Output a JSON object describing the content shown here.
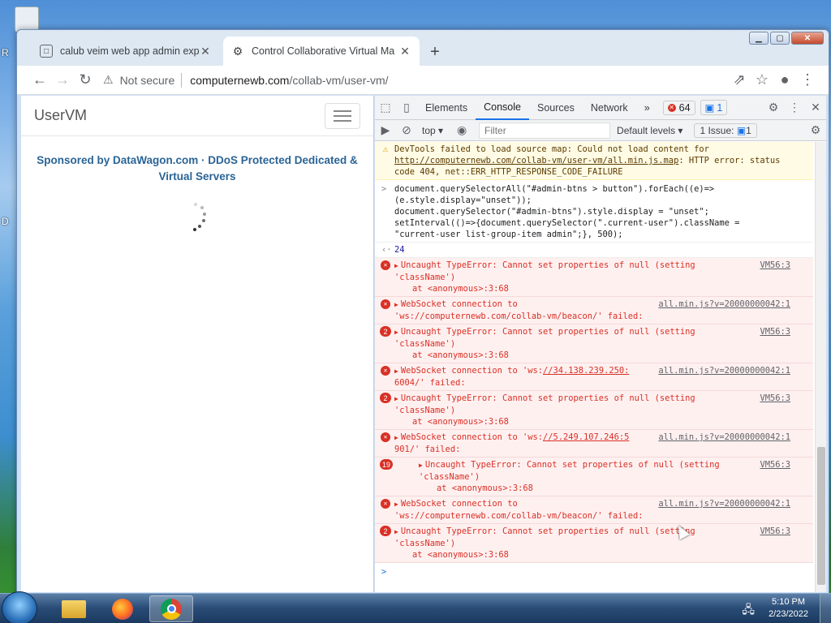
{
  "browser": {
    "tabs": [
      {
        "label": "calub veim web app admin explo",
        "favicon": "script-icon"
      },
      {
        "label": "Control Collaborative Virtual Ma",
        "favicon": "gear-icon"
      }
    ],
    "security": "Not secure",
    "url_host": "computernewb.com",
    "url_path": "/collab-vm/user-vm/"
  },
  "page": {
    "brand": "UserVM",
    "sponsor": "Sponsored by DataWagon.com · DDoS Protected Dedicated & Virtual Servers"
  },
  "devtools": {
    "tabs": [
      "Elements",
      "Console",
      "Sources",
      "Network"
    ],
    "more": "»",
    "error_count": "64",
    "message_count": "1",
    "context": "top",
    "filter_placeholder": "Filter",
    "levels": "Default levels",
    "issues": "1 Issue:",
    "issues_count": "1"
  },
  "console": {
    "warning": {
      "text_before": "DevTools failed to load source map: Could not load content for ",
      "link": "http://computernewb.com/collab-vm/user-vm/all.min.js.map",
      "text_after": ": HTTP error: status code 404, net::ERR_HTTP_RESPONSE_CODE_FAILURE"
    },
    "input_lines": [
      "document.querySelectorAll(\"#admin-btns > button\").forEach((e)=>",
      "(e.style.display=\"unset\"));",
      "document.querySelector(\"#admin-btns\").style.display = \"unset\";",
      "setInterval(()=>{document.querySelector(\".current-user\").className =",
      "\"current-user list-group-item admin\";}, 500);"
    ],
    "result": "24",
    "entries": [
      {
        "kind": "type",
        "count": "",
        "source": "VM56:3"
      },
      {
        "kind": "ws",
        "count": "",
        "before": "WebSocket connection to",
        "target": "'ws://computernewb.com/collab-vm/beacon/' failed:",
        "source": "all.min.js?v=20000000042:1"
      },
      {
        "kind": "type",
        "count": "2",
        "source": "VM56:3"
      },
      {
        "kind": "ws2",
        "count": "",
        "before": "WebSocket connection to 'ws:",
        "link": "//34.138.239.250:",
        "after": "6004/' failed:",
        "source": "all.min.js?v=20000000042:1"
      },
      {
        "kind": "type",
        "count": "2",
        "source": "VM56:3"
      },
      {
        "kind": "ws2",
        "count": "",
        "before": "WebSocket connection to 'ws:",
        "link": "//5.249.107.246:5",
        "after": "901/' failed:",
        "source": "all.min.js?v=20000000042:1"
      },
      {
        "kind": "type",
        "count": "19",
        "source": "VM56:3"
      },
      {
        "kind": "ws",
        "count": "",
        "before": "WebSocket connection to",
        "target": "'ws://computernewb.com/collab-vm/beacon/' failed:",
        "source": "all.min.js?v=20000000042:1"
      },
      {
        "kind": "type",
        "count": "2",
        "source": "VM56:3"
      }
    ],
    "type_error_line1": "Uncaught TypeError: Cannot set properties of null (setting",
    "type_error_line2": "'className')",
    "type_error_at": "at <anonymous>:3:68"
  },
  "taskbar": {
    "apps": [
      "file-explorer-icon",
      "firefox-icon",
      "chrome-icon"
    ],
    "time": "5:10 PM",
    "date": "2/23/2022"
  }
}
